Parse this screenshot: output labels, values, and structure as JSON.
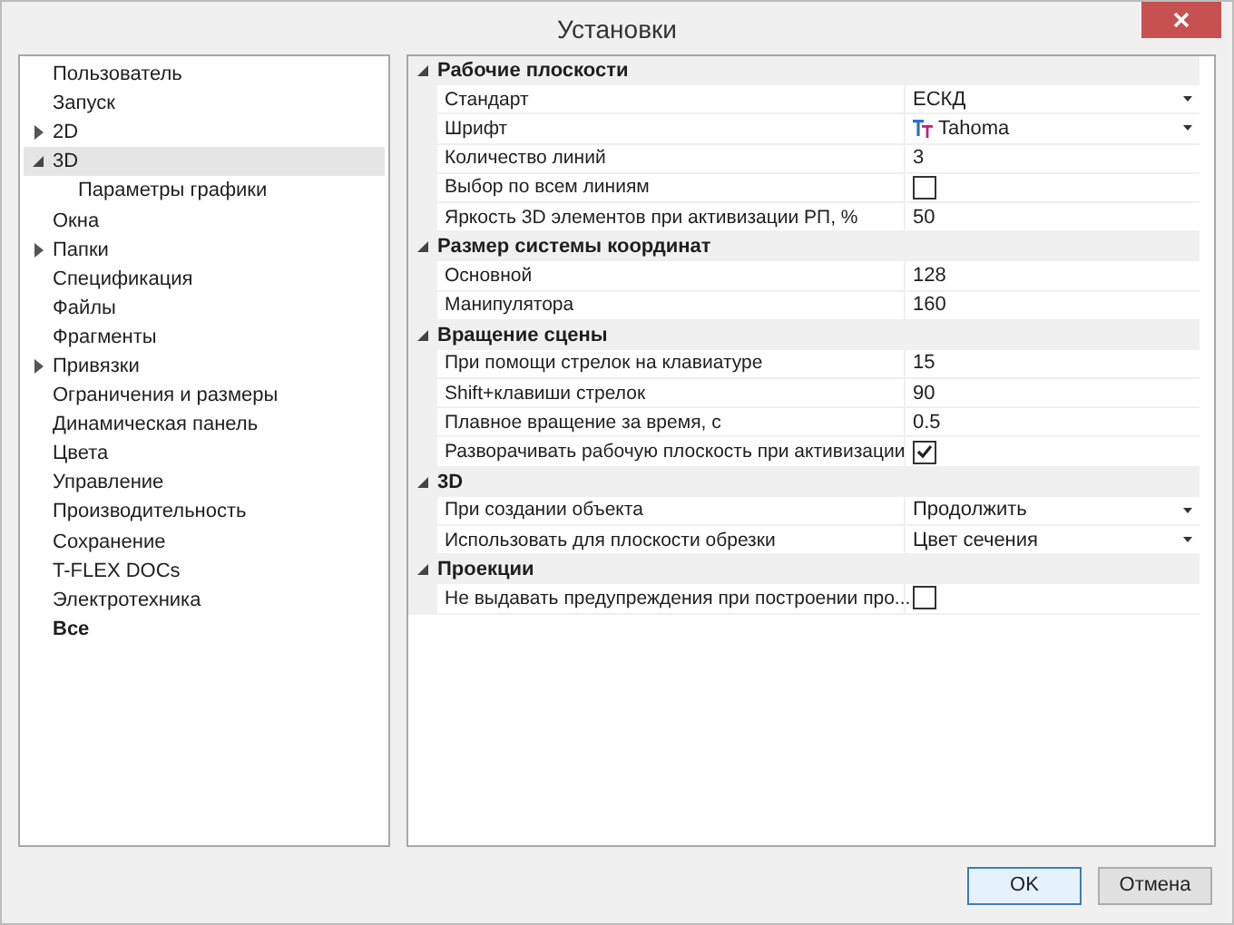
{
  "window": {
    "title": "Установки"
  },
  "sidebar": {
    "items": [
      {
        "label": "Пользователь",
        "selected": false,
        "bold": false
      },
      {
        "label": "Запуск",
        "selected": false,
        "bold": false
      },
      {
        "label": "2D",
        "selected": false,
        "bold": false,
        "expanded": false
      },
      {
        "label": "3D",
        "selected": true,
        "bold": false,
        "expanded": true,
        "children": [
          {
            "label": "Параметры графики",
            "selected": false,
            "bold": false
          }
        ]
      },
      {
        "label": "Окна",
        "selected": false,
        "bold": false
      },
      {
        "label": "Папки",
        "selected": false,
        "bold": false,
        "expanded": false
      },
      {
        "label": "Спецификация",
        "selected": false,
        "bold": false
      },
      {
        "label": "Файлы",
        "selected": false,
        "bold": false
      },
      {
        "label": "Фрагменты",
        "selected": false,
        "bold": false
      },
      {
        "label": "Привязки",
        "selected": false,
        "bold": false,
        "expanded": false
      },
      {
        "label": "Ограничения и размеры",
        "selected": false,
        "bold": false
      },
      {
        "label": "Динамическая панель",
        "selected": false,
        "bold": false
      },
      {
        "label": "Цвета",
        "selected": false,
        "bold": false
      },
      {
        "label": "Управление",
        "selected": false,
        "bold": false
      },
      {
        "label": "Производительность",
        "selected": false,
        "bold": false
      },
      {
        "label": "Сохранение",
        "selected": false,
        "bold": false
      },
      {
        "label": "T-FLEX DOCs",
        "selected": false,
        "bold": false
      },
      {
        "label": "Электротехника",
        "selected": false,
        "bold": false
      },
      {
        "label": "Все",
        "selected": false,
        "bold": true
      }
    ]
  },
  "properties": {
    "groups": [
      {
        "title": "Рабочие плоскости",
        "expanded": true,
        "rows": [
          {
            "kind": "dropdown",
            "label": "Стандарт",
            "value": "ЕСКД"
          },
          {
            "kind": "font",
            "label": "Шрифт",
            "value": "Tahoma"
          },
          {
            "kind": "text",
            "label": "Количество линий",
            "value": "3"
          },
          {
            "kind": "checkbox",
            "label": "Выбор по всем линиям",
            "checked": false
          },
          {
            "kind": "text",
            "label": "Яркость 3D элементов при активизации РП, %",
            "value": "50"
          }
        ]
      },
      {
        "title": "Размер системы координат",
        "expanded": true,
        "rows": [
          {
            "kind": "text",
            "label": "Основной",
            "value": "128"
          },
          {
            "kind": "text",
            "label": "Манипулятора",
            "value": "160"
          }
        ]
      },
      {
        "title": "Вращение сцены",
        "expanded": true,
        "rows": [
          {
            "kind": "text",
            "label": "При помощи стрелок на клавиатуре",
            "value": "15"
          },
          {
            "kind": "text",
            "label": "Shift+клавиши стрелок",
            "value": "90"
          },
          {
            "kind": "text",
            "label": "Плавное вращение за время, с",
            "value": "0.5"
          },
          {
            "kind": "checkbox",
            "label": "Разворачивать рабочую плоскость при активизации",
            "checked": true
          }
        ]
      },
      {
        "title": "3D",
        "expanded": true,
        "rows": [
          {
            "kind": "dropdown",
            "label": "При создании объекта",
            "value": "Продолжить"
          },
          {
            "kind": "dropdown",
            "label": "Использовать для плоскости обрезки",
            "value": "Цвет сечения"
          }
        ]
      },
      {
        "title": "Проекции",
        "expanded": true,
        "rows": [
          {
            "kind": "checkbox",
            "label": "Не выдавать предупреждения при построении про...",
            "checked": false
          }
        ]
      }
    ]
  },
  "buttons": [
    {
      "label": "OK",
      "default": true
    },
    {
      "label": "Отмена",
      "default": false
    }
  ]
}
